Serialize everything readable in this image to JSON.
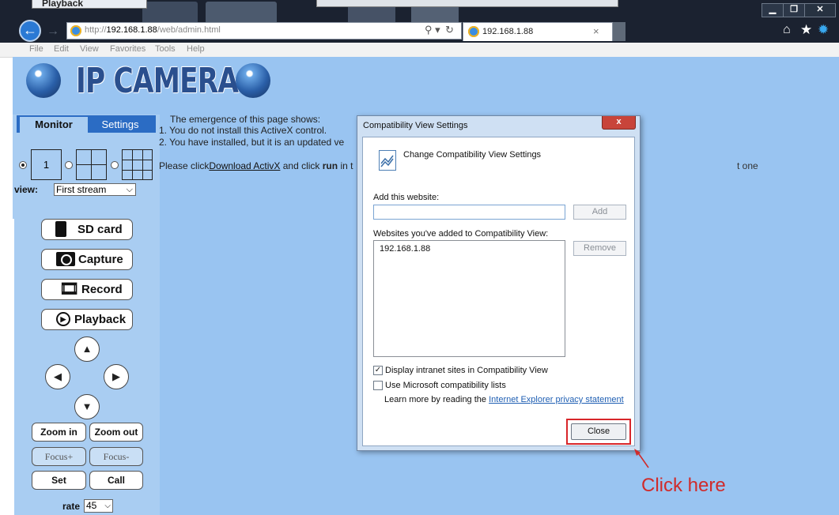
{
  "browser": {
    "prev_window_tab": "Playback",
    "url_prefix": "http://",
    "url_host": "192.168.1.88",
    "url_path": "/web/admin.html",
    "tab_title": "192.168.1.88",
    "menu": [
      "File",
      "Edit",
      "View",
      "Favorites",
      "Tools",
      "Help"
    ],
    "icons": [
      "back-icon",
      "forward-icon",
      "ie-icon",
      "search-icon",
      "refresh-icon",
      "close-icon",
      "home-icon",
      "star-icon",
      "gear-icon",
      "minimize-icon",
      "restore-icon"
    ]
  },
  "app": {
    "logo_text": "IP CAMERA",
    "tabs": {
      "monitor": "Monitor",
      "settings": "Settings"
    },
    "layout_single_label": "1",
    "view_label": "view:",
    "view_value": "First stream",
    "buttons": {
      "sd_card": "SD card",
      "capture": "Capture",
      "record": "Record",
      "playback": "Playback"
    },
    "zoom_in": "Zoom in",
    "zoom_out": "Zoom out",
    "focus_plus": "Focus+",
    "focus_minus": "Focus-",
    "set": "Set",
    "call": "Call",
    "rate_label": "rate",
    "rate_value": "45"
  },
  "message": {
    "line1": "The emergence of this page shows:",
    "line2": "1. You do not install this ActiveX control.",
    "line3": "2. You have installed, but it is an updated ve",
    "line4_prefix": "Please click",
    "line4_link": "Download ActivX",
    "line4_mid": " and click ",
    "line4_bold": "run",
    "line4_suffix": " in t",
    "fragment_right": "t one"
  },
  "dialog": {
    "title": "Compatibility View Settings",
    "close_glyph": "x",
    "heading": "Change Compatibility View Settings",
    "add_label": "Add this website:",
    "add_input_value": "",
    "add_button": "Add",
    "list_label": "Websites you've added to Compatibility View:",
    "sites": [
      "192.168.1.88"
    ],
    "remove_button": "Remove",
    "checkbox_intranet": "Display intranet sites in Compatibility View",
    "checkbox_intranet_checked": true,
    "checkbox_mslists": "Use Microsoft compatibility lists",
    "checkbox_mslists_checked": false,
    "learn_more_prefix": "Learn more by reading the ",
    "learn_more_link": "Internet Explorer privacy statement",
    "close_button": "Close"
  },
  "annotation": {
    "text": "Click here",
    "color": "#d02b2b"
  },
  "colors": {
    "page_bg": "#99c4f1",
    "panel_bg": "#a9cdf2",
    "tab_active_bar": "#2b6cc4",
    "dialog_close": "#c8443a",
    "link": "#1f5fb3"
  }
}
